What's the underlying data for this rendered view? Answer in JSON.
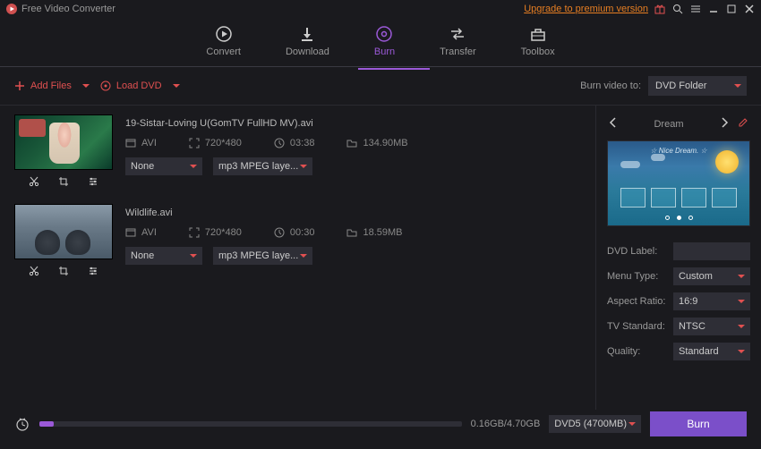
{
  "titlebar": {
    "app_name": "Free Video Converter",
    "premium_link": "Upgrade to premium version"
  },
  "tabs": {
    "convert": "Convert",
    "download": "Download",
    "burn": "Burn",
    "transfer": "Transfer",
    "toolbox": "Toolbox"
  },
  "toolbar": {
    "add_files": "Add Files",
    "load_dvd": "Load DVD",
    "burn_to_label": "Burn video to:",
    "burn_to_value": "DVD Folder"
  },
  "files": [
    {
      "name": "19-Sistar-Loving U(GomTV FullHD MV).avi",
      "format": "AVI",
      "resolution": "720*480",
      "duration": "03:38",
      "size": "134.90MB",
      "select_a": "None",
      "select_b": "mp3 MPEG laye..."
    },
    {
      "name": "Wildlife.avi",
      "format": "AVI",
      "resolution": "720*480",
      "duration": "00:30",
      "size": "18.59MB",
      "select_a": "None",
      "select_b": "mp3 MPEG laye..."
    }
  ],
  "sidebar": {
    "template_name": "Dream",
    "template_inner_title": "☆ Nice Dream. ☆",
    "labels": {
      "dvd_label": "DVD Label:",
      "menu_type": "Menu Type:",
      "aspect": "Aspect Ratio:",
      "tv": "TV Standard:",
      "quality": "Quality:"
    },
    "values": {
      "dvd_label": "",
      "menu_type": "Custom",
      "aspect": "16:9",
      "tv": "NTSC",
      "quality": "Standard"
    }
  },
  "footer": {
    "size_text": "0.16GB/4.70GB",
    "disc": "DVD5 (4700MB)",
    "burn_label": "Burn"
  }
}
